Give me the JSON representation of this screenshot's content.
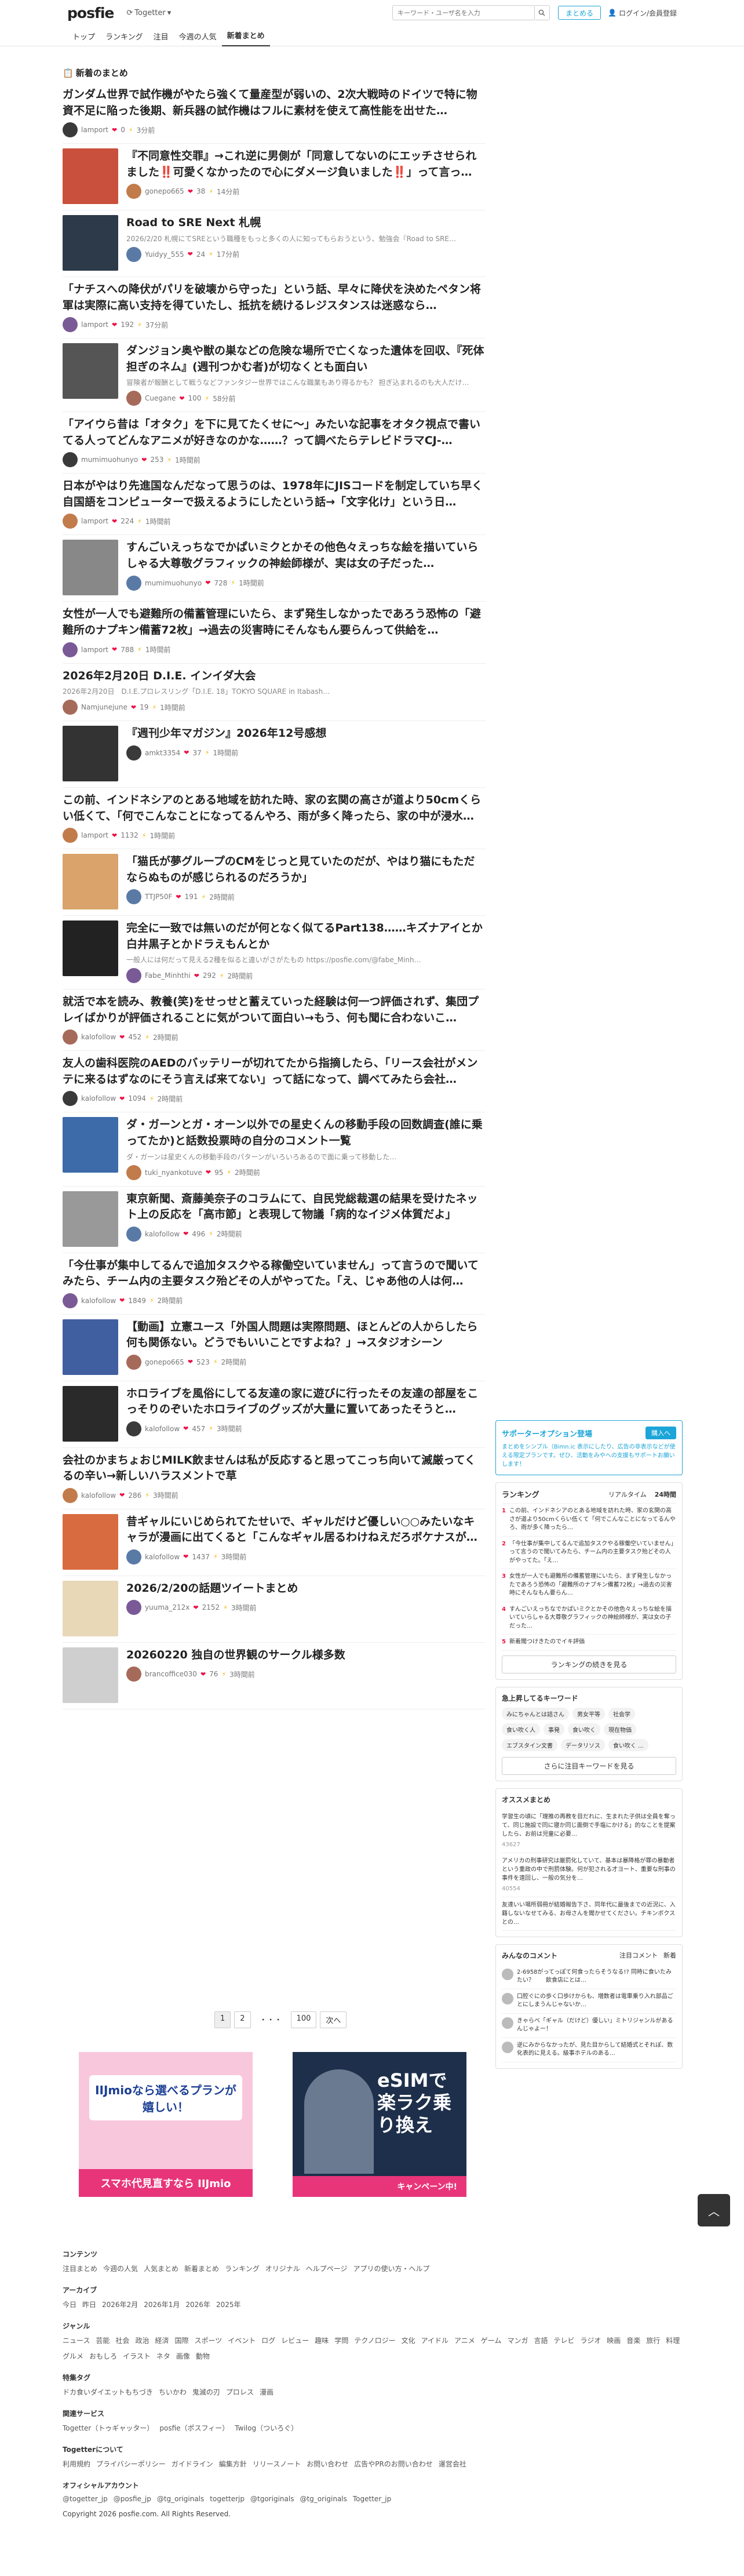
{
  "header": {
    "logo": "posfie",
    "togetter": "Togetter",
    "search_placeholder": "キーワード・ユーザ名を入力",
    "matome_btn": "まとめる",
    "login": "ログイン/会員登録",
    "nav": [
      "トップ",
      "ランキング",
      "注目",
      "今週の人気",
      "新着まとめ"
    ]
  },
  "main": {
    "section_title": "新着のまとめ",
    "items": [
      {
        "title": "ガンダム世界で試作機がやたら強くて量産型が弱いの、2次大戦時のドイツで特に物資不足に陥った後期、新兵器の試作機はフルに素材を使えて高性能を出せた…",
        "user": "lamport",
        "count": "0",
        "time": "3分前",
        "thumb": false
      },
      {
        "title": "『不同意性交罪』→これ逆に男側が「同意してないのにエッチさせられました‼️可愛くなかったので心にダメージ負いました‼️」って言っ…",
        "user": "gonepo665",
        "count": "38",
        "time": "14分前",
        "thumb": true,
        "color": "#c9503c"
      },
      {
        "title": "Road to SRE Next 札幌",
        "desc": "2026/2/20 札幌にてSREという職種をもっと多くの人に知ってもらおうという、勉強会『Road to SRE…",
        "user": "Yuidyy_555",
        "count": "24",
        "time": "17分前",
        "thumb": true,
        "color": "#2d3a4a"
      },
      {
        "title": "「ナチスへの降伏がパリを破壊から守った」という話、早々に降伏を決めたペタン将軍は実際に高い支持を得ていたし、抵抗を続けるレジスタンスは迷惑なら…",
        "user": "lamport",
        "count": "192",
        "time": "37分前",
        "thumb": false
      },
      {
        "title": "ダンジョン奥や獣の巣などの危険な場所で亡くなった遺体を回収、『死体担ぎのネム』(週刊つかむ者)が切なくとも面白い",
        "desc": "冒険者が報酬として戦うなどファンタジー世界ではこんな職業もあり得るかも？ 担ぎ込まれるのも大人だけ…",
        "user": "Cuegane",
        "count": "100",
        "time": "58分前",
        "thumb": true,
        "color": "#555"
      },
      {
        "title": "「アイウら昔は「オタク」を下に見てたくせに〜」みたいな記事をオタク視点で書いてる人ってどんなアニメが好きなのかな……？って調べたらテレビドラマCJ-…",
        "user": "mumimuohunyo",
        "count": "253",
        "time": "1時間前",
        "thumb": false
      },
      {
        "title": "日本がやはり先進国なんだなって思うのは、1978年にJISコードを制定していち早く自国語をコンピューターで扱えるようにしたという話→「文字化け」という日…",
        "user": "lamport",
        "count": "224",
        "time": "1時間前",
        "thumb": false
      },
      {
        "title": "すんごいえっちなでかぱいミクとかその他色々えっちな絵を描いていらしゃる大尊敬グラフィックの神絵師様が、実は女の子だった…",
        "user": "mumimuohunyo",
        "count": "728",
        "time": "1時間前",
        "thumb": true,
        "color": "#888"
      },
      {
        "title": "女性が一人でも避難所の備蓄管理にいたら、まず発生しなかったであろう恐怖の「避難所のナプキン備蓄72枚」→過去の災害時にそんなもん要らんって供給を…",
        "user": "lamport",
        "count": "788",
        "time": "1時間前",
        "thumb": false
      },
      {
        "title": "2026年2月20日 D.I.E. インイダ大会",
        "desc": "2026年2月20日　D.I.E.プロレスリング「D.I.E. 18」TOKYO SQUARE in Itabash…",
        "user": "Namjunejune",
        "count": "19",
        "time": "1時間前",
        "thumb": false
      },
      {
        "title": "『週刊少年マガジン』2026年12号感想",
        "user": "amkt3354",
        "count": "37",
        "time": "1時間前",
        "thumb": true,
        "color": "#333"
      },
      {
        "title": "この前、インドネシアのとある地域を訪れた時、家の玄関の高さが道より50cmくらい低くて、「何でこんなことになってるんやろ、雨が多く降ったら、家の中が浸水…",
        "user": "lamport",
        "count": "1132",
        "time": "1時間前",
        "thumb": false
      },
      {
        "title": "「猫氏が夢グループのCMをじっと見ていたのだが、やはり猫にもただならぬものが感じられるのだろうか」",
        "user": "TTJP50F",
        "count": "191",
        "time": "2時間前",
        "thumb": true,
        "color": "#d9a36b"
      },
      {
        "title": "完全に一致では無いのだが何となく似てるPart138……キズナアイとか白井黒子とかドラえもんとか",
        "desc": "一般人には何だって見える2種を似ると違いがさがたもの https://posfie.com/@fabe_Minh…",
        "user": "Fabe_Minhthi",
        "count": "292",
        "time": "2時間前",
        "thumb": true,
        "color": "#222"
      },
      {
        "title": "就活で本を読み、教養(笑)をせっせと蓄えていった経験は何一つ評価されず、集団プレイばかりが評価されることに気がついて面白い→もう、何も聞に合わないこ…",
        "user": "kalofollow",
        "count": "452",
        "time": "2時間前",
        "thumb": false
      },
      {
        "title": "友人の歯科医院のAEDのバッテリーが切れてたから指摘したら、「リース会社がメンテに来るはずなのにそう言えば来てない」って話になって、調べてみたら会社…",
        "user": "kalofollow",
        "count": "1094",
        "time": "2時間前",
        "thumb": false
      },
      {
        "title": "ダ・ガーンとガ・オーン以外での星史くんの移動手段の回数調査(誰に乗ってたか)と話数投票時の自分のコメント一覧",
        "desc": "ダ・ガーンは星史くんの移動手段のパターンがいろいろあるので面に乗って移動した…",
        "user": "tuki_nyankotuve",
        "count": "95",
        "time": "2時間前",
        "thumb": true,
        "color": "#3d6aa8"
      },
      {
        "title": "東京新聞、斎藤美奈子のコラムにて、自民党総裁選の結果を受けたネット上の反応を「高市節」と表現して物議「病的なイジメ体質だよ」",
        "user": "kalofollow",
        "count": "496",
        "time": "2時間前",
        "thumb": true,
        "color": "#999"
      },
      {
        "title": "「今仕事が集中してるんで追加タスクやる稼働空いていません」って言うので聞いてみたら、チーム内の主要タスク殆どその人がやってた。「え、じゃあ他の人は何…",
        "user": "kalofollow",
        "count": "1849",
        "time": "2時間前",
        "thumb": false
      },
      {
        "title": "【動画】立憲ユース「外国人問題は実際問題、ほとんどの人からしたら何も関係ない。どうでもいいことですよね？」→スタジオシーン",
        "user": "gonepo665",
        "count": "523",
        "time": "2時間前",
        "thumb": true,
        "color": "#405fa0"
      },
      {
        "title": "ホロライブを風俗にしてる友達の家に遊びに行ったその友達の部屋をこっそりのぞいたホロライブのグッズが大量に置いてあったそうと…",
        "user": "kalofollow",
        "count": "457",
        "time": "3時間前",
        "thumb": true,
        "color": "#2a2a2a"
      },
      {
        "title": "会社のかまちょおじMILK飲ませんは私が反応すると思ってこっち向いて滅厳ってくるの辛い→新しいハラスメントで草",
        "user": "kalofollow",
        "count": "286",
        "time": "3時間前",
        "thumb": false
      },
      {
        "title": "昔ギャルにいじめられてたせいで、ギャルだけど優しい○○みたいなキャラが漫画に出てくると「こんなギャル居るわけねえだろボケナスが…",
        "user": "kalofollow",
        "count": "1437",
        "time": "3時間前",
        "thumb": true,
        "color": "#d86b3f"
      },
      {
        "title": "2026/2/20の話題ツイートまとめ",
        "user": "yuuma_212x",
        "count": "2152",
        "time": "3時間前",
        "thumb": true,
        "color": "#e8d8b8"
      },
      {
        "title": "20260220 独自の世界観のサークル様多数",
        "user": "brancoffice030",
        "count": "76",
        "time": "3時間前",
        "thumb": true,
        "color": "#cfcfcf"
      }
    ],
    "pager": [
      "1",
      "2",
      "・・・",
      "100",
      "次へ"
    ]
  },
  "ads": {
    "left_title": "スマホ代見直すなら IIJmio",
    "left_sub": "IIJmioなら選べるプランが嬉しい！",
    "right_title": "eSIMで楽ラク乗り換え",
    "right_sub": "キャンペーン中!"
  },
  "sidebar": {
    "supporter_title": "サポーターオプション登場",
    "supporter_btn": "購入へ",
    "supporter_desc": "まとめをシンプル（Bimn.ic 表示にしたり、広告の非表示などが使える限定プランです。ぜひ、活動をみやへの支援もサポートお願いします！",
    "ranking_title": "ランキング",
    "ranking_tabs": [
      "リアルタイム",
      "24時間"
    ],
    "ranking_items": [
      "この前、インドネシアのとある地域を訪れた時、家の玄関の高さが道より50cmくらい低くて「何でこんなことになってるんやろ、雨が多く降ったら…",
      "「今仕事が集中してるんで追加タスクやる稼働空いていません」って言うので聞いてみたら、チーム内の主要タスク殆どその人がやってた。「え…",
      "女性が一人でも避難所の備蓄管理にいたら、まず発生しなかったであろう恐怖の「避難所のナプキン備蓄72枚」→過去の災害時にそんなもん要らん…",
      "すんごいえっちなでかぱいミクとかその他色々えっちな絵を描いていらしゃる大尊敬グラフィックの神絵師様が、実は女の子だった…",
      "新着聞つけきたのでイキ評価"
    ],
    "ranking_more": "ランキングの続きを見る",
    "keywords_title": "急上昇してるキーワード",
    "keywords": [
      "みにちゃんとは詰さん",
      "男女平等",
      "社会学",
      "食い吹く人",
      "事発",
      "食い吹く",
      "現在物価",
      "エブスタイン文書",
      "データリソス",
      "食い吹く ..."
    ],
    "keywords_more": "さらに注目キーワードを見る",
    "recommend_title": "オススメまとめ",
    "recommend_items": [
      "学習生の頃に「理推の再教を目だれに、生まれた子供は全員を奪って、同じ施設で同に寝か同じ面倒で手塩にかける」的なことを提案したら、お前は児童に必要…",
      "アメリカの刑事研究は厳罰化していて、基本は暴降格が罪の暴動者という重政の中で刑罰体験。何が犯される才ヨート、重要な刑事の事件を遠回し、一般の気分を…",
      "友達いい場所弱冊が結婚報告下さ、同年代に最後までの近況に、入籍しないなせてみる、お母さんを聞かせてください。チキンボクスとの…"
    ],
    "recommend_meta": [
      "43627",
      "40554"
    ],
    "comments_title": "みんなのコメント",
    "comments_tabs": [
      "注目コメント",
      "新着"
    ],
    "comments": [
      "2-6958がってっぽて何食ったらそうなる!? 同時に食いたみたい？　　飲食店にとは…",
      "口腔ぐにの歩く口歩けからも、増数者は電車乗り入れ部品ごとにしまうんじゃないか…",
      "きゃらべ「ギャル（だけど）優しい」ミトリジャンルがあるんじゃよー！",
      "逆にみからなかったが、見た目からして結婚式とそれぽ、数化表的に見える。級事ホテルのある…"
    ]
  },
  "footer": {
    "contents_title": "コンテンツ",
    "contents": [
      "注目まとめ",
      "今週の人気",
      "人気まとめ",
      "新着まとめ",
      "ランキング",
      "オリジナル",
      "ヘルプページ",
      "アプリの使い方・ヘルプ"
    ],
    "archive_title": "アーカイブ",
    "archive": [
      "今日",
      "昨日",
      "2026年2月",
      "2026年1月",
      "2026年",
      "2025年"
    ],
    "genre_title": "ジャンル",
    "genre": [
      "ニュース",
      "芸能",
      "社会",
      "政治",
      "経済",
      "国際",
      "スポーツ",
      "イベント",
      "ログ",
      "レビュー",
      "趣味",
      "学問",
      "テクノロジー",
      "文化",
      "アイドル",
      "アニメ",
      "ゲーム",
      "マンガ",
      "言語",
      "テレビ",
      "ラジオ",
      "映画",
      "音楽",
      "旅行",
      "料理",
      "グルメ",
      "おもしろ",
      "イラスト",
      "ネタ",
      "画像",
      "動物"
    ],
    "special_title": "特集タグ",
    "special": [
      "ドカ食いダイエットもちづき",
      "ちいかわ",
      "鬼滅の刃",
      "プロレス",
      "漫画"
    ],
    "services_title": "関連サービス",
    "services": [
      "Togetter（トゥギャッター）",
      "posfie（ポスフィー）",
      "Twilog（ついろぐ）"
    ],
    "about_title": "Togetterについて",
    "about": [
      "利用規約",
      "プライバシーポリシー",
      "ガイドライン",
      "編集方針",
      "リリースノート",
      "お問い合わせ",
      "広告やPRのお問い合わせ",
      "運営会社"
    ],
    "official_title": "オフィシャルアカウント",
    "official": [
      "@togetter_jp",
      "@posfie_jp",
      "@tg_originals",
      "togetterjp",
      "@tgoriginals",
      "@tg_originals",
      "Togetter_jp"
    ],
    "copyright": "Copyright 2026 posfie.com. All Rights Reserved."
  }
}
